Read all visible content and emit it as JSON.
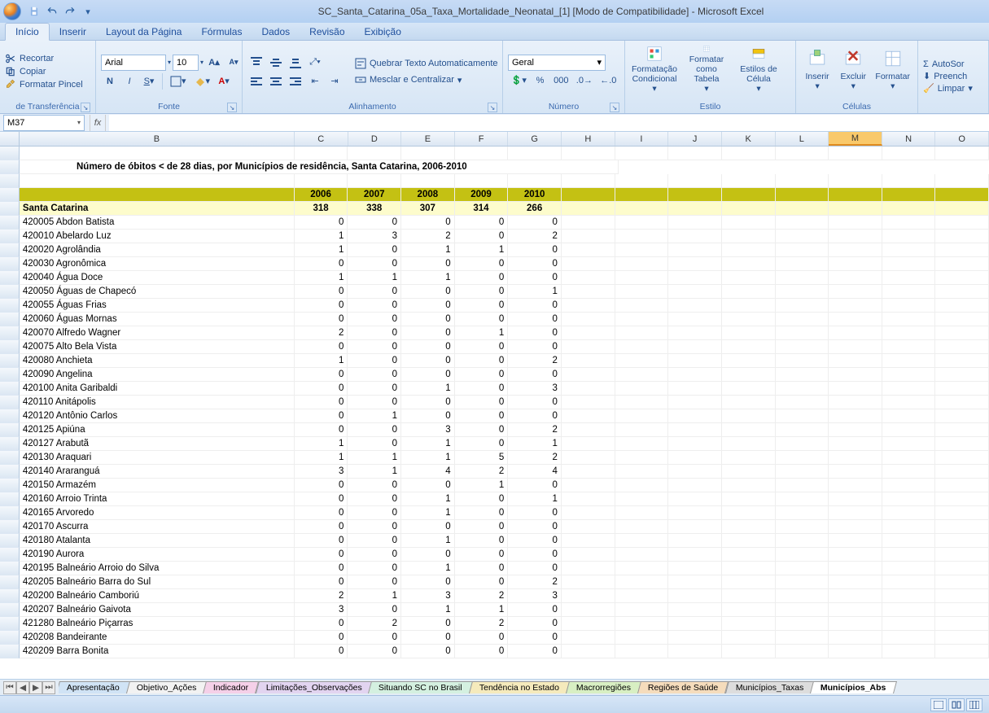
{
  "titlebar": {
    "title": "SC_Santa_Catarina_05a_Taxa_Mortalidade_Neonatal_[1]  [Modo de Compatibilidade] - Microsoft Excel"
  },
  "tabs": {
    "items": [
      "Início",
      "Inserir",
      "Layout da Página",
      "Fórmulas",
      "Dados",
      "Revisão",
      "Exibição"
    ],
    "active": 0
  },
  "ribbon": {
    "clipboard": {
      "cut": "Recortar",
      "copy": "Copiar",
      "painter": "Formatar Pincel",
      "group": "de Transferência"
    },
    "font": {
      "name": "Arial",
      "size": "10",
      "group": "Fonte"
    },
    "align": {
      "wrap": "Quebrar Texto Automaticamente",
      "merge": "Mesclar e Centralizar",
      "group": "Alinhamento"
    },
    "number": {
      "format": "Geral",
      "group": "Número"
    },
    "styles": {
      "cond": "Formatação Condicional",
      "table": "Formatar como Tabela",
      "cell": "Estilos de Célula",
      "group": "Estilo"
    },
    "cells": {
      "insert": "Inserir",
      "delete": "Excluir",
      "format": "Formatar",
      "group": "Células"
    },
    "editing": {
      "autosum": "AutoSor",
      "fill": "Preench",
      "clear": "Limpar"
    }
  },
  "formula": {
    "namebox": "M37",
    "value": ""
  },
  "columns": [
    "B",
    "C",
    "D",
    "E",
    "F",
    "G",
    "H",
    "I",
    "J",
    "K",
    "L",
    "M",
    "N",
    "O"
  ],
  "selectedCol": "M",
  "sheet": {
    "title": "Número de óbitos < de 28 dias, por Municípios de residência, Santa Catarina, 2006-2010",
    "years": [
      "2006",
      "2007",
      "2008",
      "2009",
      "2010"
    ],
    "total_label": "Santa Catarina",
    "total_values": [
      "318",
      "338",
      "307",
      "314",
      "266"
    ],
    "rows": [
      {
        "label": "420005 Abdon Batista",
        "v": [
          "0",
          "0",
          "0",
          "0",
          "0"
        ]
      },
      {
        "label": "420010 Abelardo Luz",
        "v": [
          "1",
          "3",
          "2",
          "0",
          "2"
        ]
      },
      {
        "label": "420020 Agrolândia",
        "v": [
          "1",
          "0",
          "1",
          "1",
          "0"
        ]
      },
      {
        "label": "420030 Agronômica",
        "v": [
          "0",
          "0",
          "0",
          "0",
          "0"
        ]
      },
      {
        "label": "420040 Água Doce",
        "v": [
          "1",
          "1",
          "1",
          "0",
          "0"
        ]
      },
      {
        "label": "420050 Águas de Chapecó",
        "v": [
          "0",
          "0",
          "0",
          "0",
          "1"
        ]
      },
      {
        "label": "420055 Águas Frias",
        "v": [
          "0",
          "0",
          "0",
          "0",
          "0"
        ]
      },
      {
        "label": "420060 Águas Mornas",
        "v": [
          "0",
          "0",
          "0",
          "0",
          "0"
        ]
      },
      {
        "label": "420070 Alfredo Wagner",
        "v": [
          "2",
          "0",
          "0",
          "1",
          "0"
        ]
      },
      {
        "label": "420075 Alto Bela Vista",
        "v": [
          "0",
          "0",
          "0",
          "0",
          "0"
        ]
      },
      {
        "label": "420080 Anchieta",
        "v": [
          "1",
          "0",
          "0",
          "0",
          "2"
        ]
      },
      {
        "label": "420090 Angelina",
        "v": [
          "0",
          "0",
          "0",
          "0",
          "0"
        ]
      },
      {
        "label": "420100 Anita Garibaldi",
        "v": [
          "0",
          "0",
          "1",
          "0",
          "3"
        ]
      },
      {
        "label": "420110 Anitápolis",
        "v": [
          "0",
          "0",
          "0",
          "0",
          "0"
        ]
      },
      {
        "label": "420120 Antônio Carlos",
        "v": [
          "0",
          "1",
          "0",
          "0",
          "0"
        ]
      },
      {
        "label": "420125 Apiúna",
        "v": [
          "0",
          "0",
          "3",
          "0",
          "2"
        ]
      },
      {
        "label": "420127 Arabutã",
        "v": [
          "1",
          "0",
          "1",
          "0",
          "1"
        ]
      },
      {
        "label": "420130 Araquari",
        "v": [
          "1",
          "1",
          "1",
          "5",
          "2"
        ]
      },
      {
        "label": "420140 Araranguá",
        "v": [
          "3",
          "1",
          "4",
          "2",
          "4"
        ]
      },
      {
        "label": "420150 Armazém",
        "v": [
          "0",
          "0",
          "0",
          "1",
          "0"
        ]
      },
      {
        "label": "420160 Arroio Trinta",
        "v": [
          "0",
          "0",
          "1",
          "0",
          "1"
        ]
      },
      {
        "label": "420165 Arvoredo",
        "v": [
          "0",
          "0",
          "1",
          "0",
          "0"
        ]
      },
      {
        "label": "420170 Ascurra",
        "v": [
          "0",
          "0",
          "0",
          "0",
          "0"
        ]
      },
      {
        "label": "420180 Atalanta",
        "v": [
          "0",
          "0",
          "1",
          "0",
          "0"
        ]
      },
      {
        "label": "420190 Aurora",
        "v": [
          "0",
          "0",
          "0",
          "0",
          "0"
        ]
      },
      {
        "label": "420195 Balneário Arroio do Silva",
        "v": [
          "0",
          "0",
          "1",
          "0",
          "0"
        ]
      },
      {
        "label": "420205 Balneário Barra do Sul",
        "v": [
          "0",
          "0",
          "0",
          "0",
          "2"
        ]
      },
      {
        "label": "420200 Balneário Camboriú",
        "v": [
          "2",
          "1",
          "3",
          "2",
          "3"
        ]
      },
      {
        "label": "420207 Balneário Gaivota",
        "v": [
          "3",
          "0",
          "1",
          "1",
          "0"
        ]
      },
      {
        "label": "421280 Balneário Piçarras",
        "v": [
          "0",
          "2",
          "0",
          "2",
          "0"
        ]
      },
      {
        "label": "420208 Bandeirante",
        "v": [
          "0",
          "0",
          "0",
          "0",
          "0"
        ]
      },
      {
        "label": "420209 Barra Bonita",
        "v": [
          "0",
          "0",
          "0",
          "0",
          "0"
        ]
      }
    ]
  },
  "sheets": [
    {
      "label": "Apresentação",
      "cls": "c-blue"
    },
    {
      "label": "Objetivo_Ações",
      "cls": ""
    },
    {
      "label": "Indicador",
      "cls": "c-pink"
    },
    {
      "label": "Limitações_Observações",
      "cls": "c-purple"
    },
    {
      "label": "Situando SC no Brasil",
      "cls": "c-mint"
    },
    {
      "label": "Tendência no Estado",
      "cls": "c-yellow"
    },
    {
      "label": "Macrorregiões",
      "cls": "c-green"
    },
    {
      "label": "Regiões de Saúde",
      "cls": "c-orange"
    },
    {
      "label": "Municípios_Taxas",
      "cls": "c-gray"
    },
    {
      "label": "Municípios_Abs",
      "cls": "active"
    }
  ]
}
